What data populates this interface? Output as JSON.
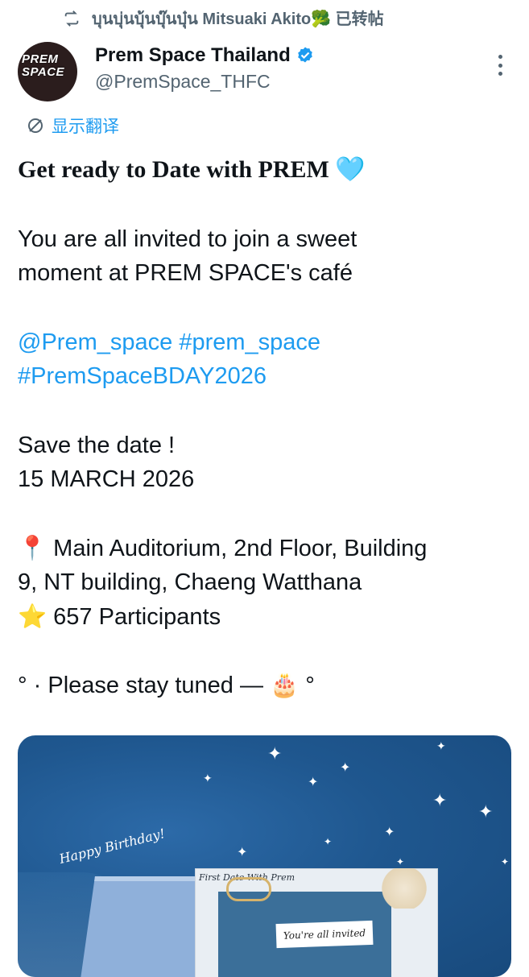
{
  "retweet": {
    "icon": "retweet-icon",
    "text": "บุนบุ่นบุ้นบุ๊นบุ๋น Mitsuaki Akito🥦 已转帖"
  },
  "author": {
    "avatar_text": "PREM SPACE",
    "name": "Prem Space Thailand",
    "handle": "@PremSpace_THFC",
    "verified_color": "#1d9bf0"
  },
  "translate": {
    "label": "显示翻译",
    "icon": "translate-icon"
  },
  "tweet": {
    "headline": "Get ready to Date with PREM 🩵",
    "line1": "You are all invited to join a sweet",
    "line2": "moment at PREM SPACE's café",
    "mention": "@Prem_space",
    "hashtag1": "#prem_space",
    "hashtag2": "#PremSpaceBDAY2026",
    "save_date": "Save the date !",
    "date": "15 MARCH 2026",
    "location_line1": "📍 Main Auditorium, 2nd Floor, Building",
    "location_line2": "9, NT building, Chaeng Watthana",
    "participants": "⭐ 657 Participants",
    "tuned": "° · Please stay tuned —  🎂 °"
  },
  "media": {
    "happy_birthday": "Happy Birthday!",
    "card_title": "First Date With Prem",
    "ribbon": "You're all invited"
  },
  "colors": {
    "link": "#1d9bf0",
    "secondary": "#536471"
  }
}
